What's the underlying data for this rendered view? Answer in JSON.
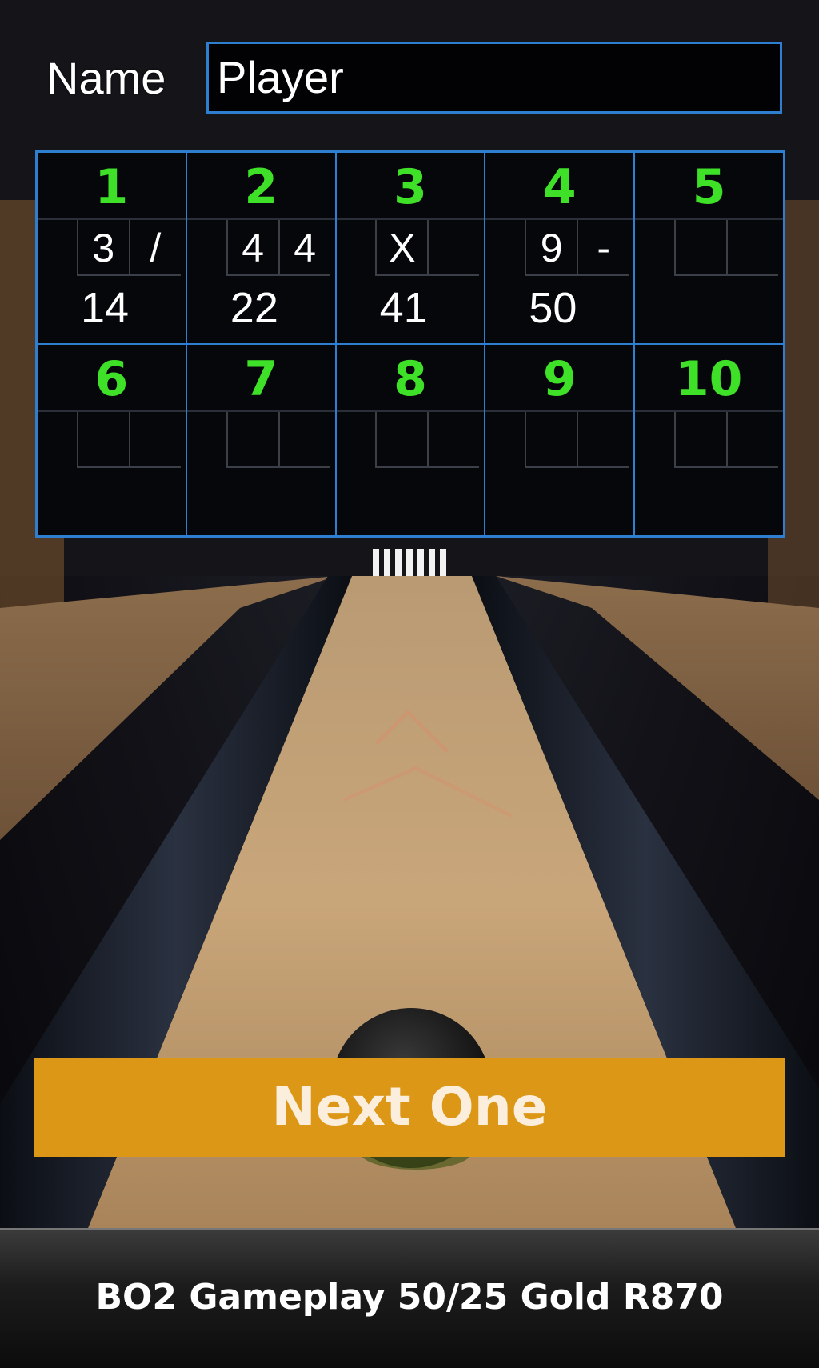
{
  "player": {
    "name_label": "Name",
    "name_value": "Player"
  },
  "scoreboard": {
    "frames": [
      {
        "number": "1",
        "roll1": "3",
        "roll2": "/",
        "total": "14"
      },
      {
        "number": "2",
        "roll1": "4",
        "roll2": "4",
        "total": "22"
      },
      {
        "number": "3",
        "roll1": "X",
        "roll2": "",
        "total": "41"
      },
      {
        "number": "4",
        "roll1": "9",
        "roll2": "-",
        "total": "50"
      },
      {
        "number": "5",
        "roll1": "",
        "roll2": "",
        "total": ""
      },
      {
        "number": "6",
        "roll1": "",
        "roll2": "",
        "total": ""
      },
      {
        "number": "7",
        "roll1": "",
        "roll2": "",
        "total": ""
      },
      {
        "number": "8",
        "roll1": "",
        "roll2": "",
        "total": ""
      },
      {
        "number": "9",
        "roll1": "",
        "roll2": "",
        "total": ""
      },
      {
        "number": "10",
        "roll1": "",
        "roll2": "",
        "total": ""
      }
    ]
  },
  "actions": {
    "next_label": "Next One"
  },
  "footer": {
    "text": "BO2 Gameplay 50/25 Gold R870"
  },
  "colors": {
    "frame_number": "#3ee028",
    "board_border": "#2f7fd0",
    "button": "#dc9717"
  }
}
